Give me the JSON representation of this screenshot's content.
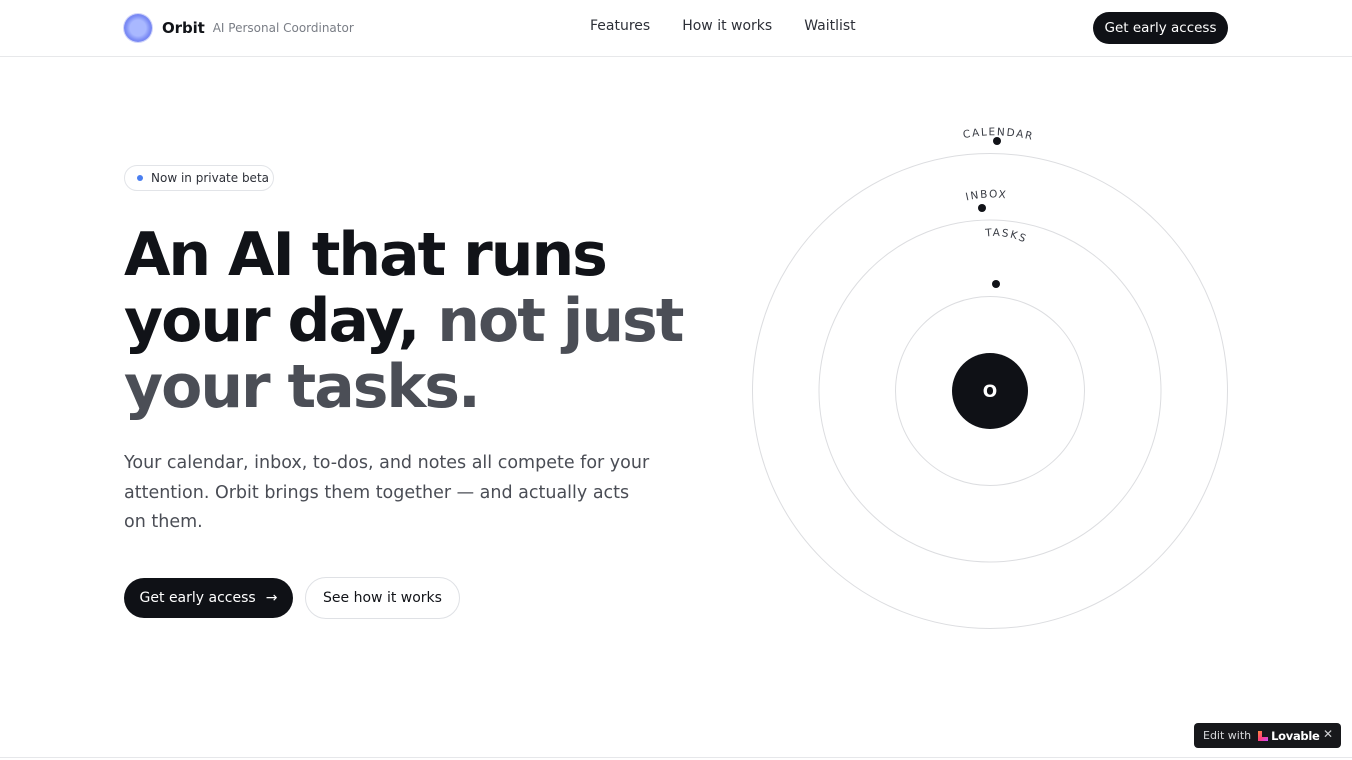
{
  "header": {
    "brand_name": "Orbit",
    "brand_tag": "AI Personal Coordinator",
    "nav": [
      "Features",
      "How it works",
      "Waitlist"
    ],
    "cta_label": "Get early access"
  },
  "hero": {
    "badge": "Now in private beta",
    "headline_part1": "An AI that runs your day, ",
    "headline_part2": "not just your tasks.",
    "subtitle": "Your calendar, inbox, to-dos, and notes all compete for your attention. Orbit brings them together — and actually acts on them.",
    "primary_button": "Get early access",
    "primary_button_icon": "arrow-right-icon",
    "secondary_button": "See how it works"
  },
  "orbit": {
    "center_letter": "O",
    "rings": [
      {
        "label": "TASKS"
      },
      {
        "label": "INBOX"
      },
      {
        "label": "CALENDAR"
      }
    ]
  },
  "lovable_pill": {
    "edit_with": "Edit with",
    "brand": "Lovable",
    "close_icon": "close-icon"
  },
  "colors": {
    "text": "#111318",
    "muted_headline": "#4b4e56",
    "button_dark": "#0f1116",
    "badge_dot": "#4a7ef0",
    "logo": "#7c8cf5"
  }
}
